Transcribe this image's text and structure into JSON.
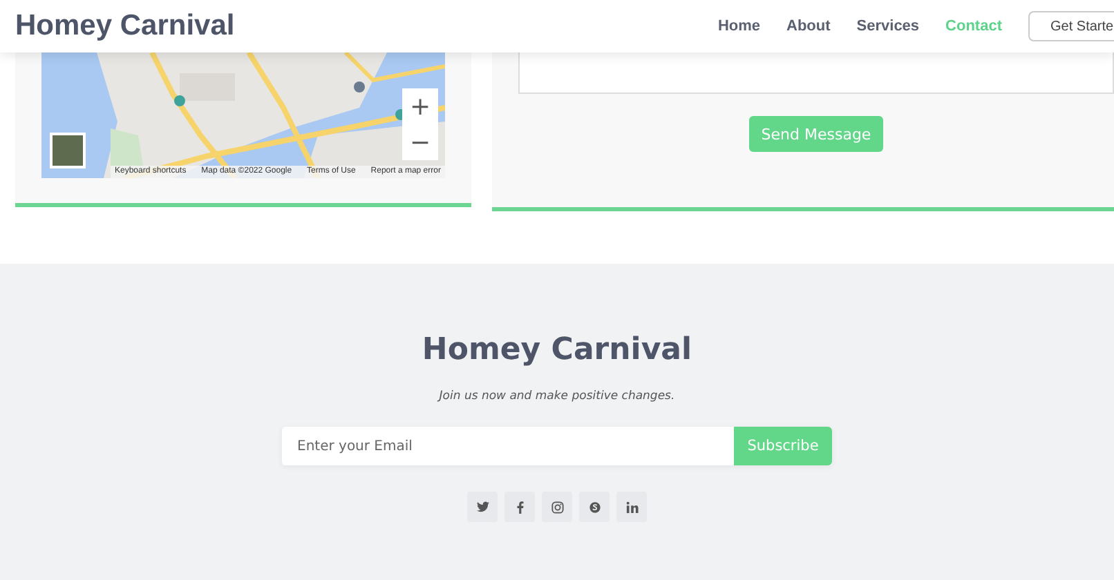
{
  "header": {
    "brand": "Homey Carnival",
    "nav": [
      {
        "label": "Home",
        "selected": false
      },
      {
        "label": "About",
        "selected": false
      },
      {
        "label": "Services",
        "selected": false
      },
      {
        "label": "Contact",
        "selected": true
      }
    ],
    "cta": "Get Starte"
  },
  "map": {
    "zoom_in": "+",
    "zoom_out": "−",
    "attribution": [
      "Keyboard shortcuts",
      "Map data ©2022 Google",
      "Terms of Use",
      "Report a map error"
    ]
  },
  "contact": {
    "send_button": "Send Message"
  },
  "footer": {
    "brand": "Homey Carnival",
    "tagline": "Join us now and make positive changes.",
    "email": {
      "placeholder": "Enter your Email"
    },
    "subscribe": "Subscribe",
    "social": [
      {
        "kind": "twitter"
      },
      {
        "kind": "facebook"
      },
      {
        "kind": "instagram"
      },
      {
        "kind": "skype"
      },
      {
        "kind": "linkedin"
      }
    ]
  }
}
